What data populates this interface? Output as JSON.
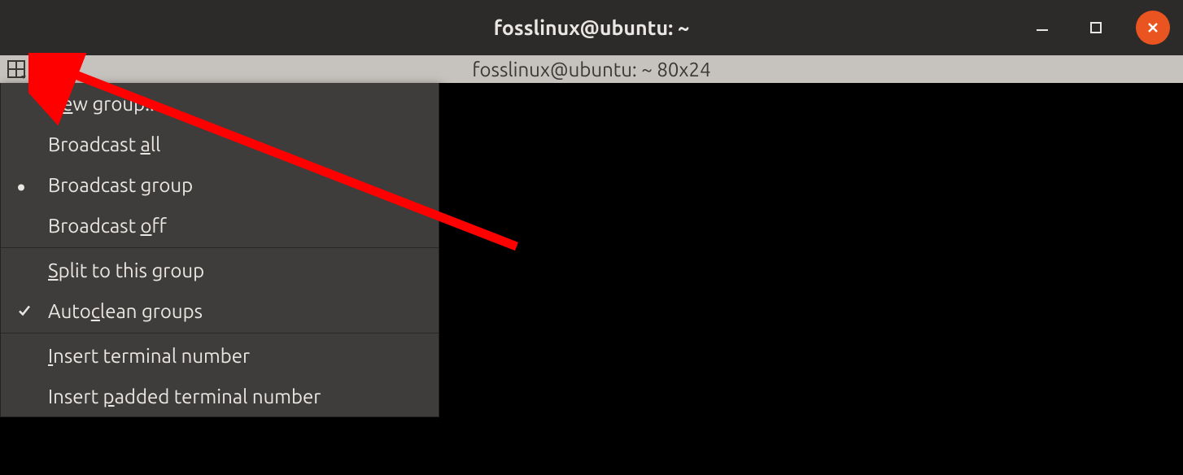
{
  "titlebar": {
    "title": "fosslinux@ubuntu: ~"
  },
  "tab": {
    "title": "fosslinux@ubuntu: ~ 80x24"
  },
  "menu": {
    "items": [
      {
        "label": "New group...",
        "type": "plain",
        "underline_idx": 1
      },
      {
        "label": "Broadcast all",
        "type": "plain",
        "underline_idx": 10
      },
      {
        "label": "Broadcast group",
        "type": "radio",
        "checked": true,
        "underline_idx": 10
      },
      {
        "label": "Broadcast off",
        "type": "plain",
        "underline_idx": 10
      },
      {
        "sep": true
      },
      {
        "label": "Split to this group",
        "type": "plain",
        "underline_idx": 0
      },
      {
        "label": "Autoclean groups",
        "type": "check",
        "checked": true,
        "underline_idx": 4
      },
      {
        "sep": true
      },
      {
        "label": "Insert terminal number",
        "type": "plain",
        "underline_idx": 0
      },
      {
        "label": "Insert padded terminal number",
        "type": "plain",
        "underline_idx": 7
      }
    ]
  },
  "colors": {
    "close_button": "#e95420",
    "arrow": "#ff0000"
  }
}
